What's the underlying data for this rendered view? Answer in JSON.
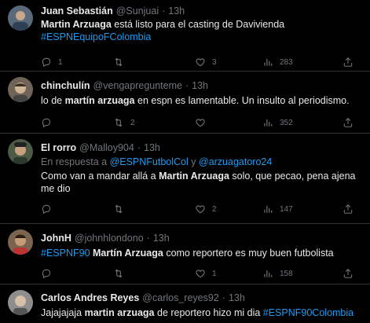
{
  "tweets": [
    {
      "name": "Juan Sebastián",
      "handle": "@Sunjuai",
      "time": "13h",
      "reply_to": null,
      "text_parts": [
        {
          "t": "Martin Arzuaga",
          "b": true
        },
        {
          "t": " está listo para el casting de Davivienda"
        },
        {
          "br": true
        },
        {
          "t": "#ESPNEquipoFColombia",
          "tag": true
        }
      ],
      "replies": "1",
      "retweets": "",
      "likes": "3",
      "views": "283",
      "avatar_color": "#6b7b8c"
    },
    {
      "name": "chinchulín",
      "handle": "@vengapreguntеme",
      "time": "13h",
      "reply_to": null,
      "text_parts": [
        {
          "t": "lo de "
        },
        {
          "t": "martín arzuaga",
          "b": true
        },
        {
          "t": " en espn es lamentable. Un insulto al periodismo."
        }
      ],
      "replies": "",
      "retweets": "2",
      "likes": "",
      "views": "352",
      "avatar_color": "#8a7a6a"
    },
    {
      "name": "El rorro",
      "handle": "@Malloy904",
      "time": "13h",
      "reply_to": {
        "prefix": "En respuesta a ",
        "mentions": [
          "@ESPNFutbolCol",
          "@arzuagatoro24"
        ],
        "joiner": " y "
      },
      "text_parts": [
        {
          "t": "Como van a mandar allá a "
        },
        {
          "t": "Martin Arzuaga",
          "b": true
        },
        {
          "t": " solo, que pecao, pena ajena me dio"
        }
      ],
      "replies": "",
      "retweets": "",
      "likes": "2",
      "views": "147",
      "avatar_color": "#7c8a6e"
    },
    {
      "name": "JohnH",
      "handle": "@johnhlondono",
      "time": "13h",
      "reply_to": null,
      "text_parts": [
        {
          "t": "#ESPNF90",
          "tag": true
        },
        {
          "t": " "
        },
        {
          "t": "Martín Arzuaga",
          "b": true
        },
        {
          "t": " como reportero es muy buen futbolista"
        }
      ],
      "replies": "",
      "retweets": "",
      "likes": "1",
      "views": "158",
      "avatar_color": "#9a8066"
    },
    {
      "name": "Carlos Andres Reyes",
      "handle": "@carlos_reyes92",
      "time": "13h",
      "reply_to": null,
      "text_parts": [
        {
          "t": "Jajajajaja "
        },
        {
          "t": "martin arzuaga",
          "b": true
        },
        {
          "t": " de reportero hizo mi dia "
        },
        {
          "t": "#ESPNF90Colombia",
          "tag": true
        }
      ],
      "replies": "",
      "retweets": "",
      "likes": "",
      "views": "",
      "avatar_color": "#a5a5a5"
    }
  ],
  "icons": {
    "reply": "reply-icon",
    "retweet": "retweet-icon",
    "like": "heart-icon",
    "views": "views-icon",
    "share": "share-icon"
  },
  "colors": {
    "background": "#000000",
    "text": "#e7e9ea",
    "muted": "#71767b",
    "link": "#1d9bf0",
    "border": "#2f3336"
  }
}
